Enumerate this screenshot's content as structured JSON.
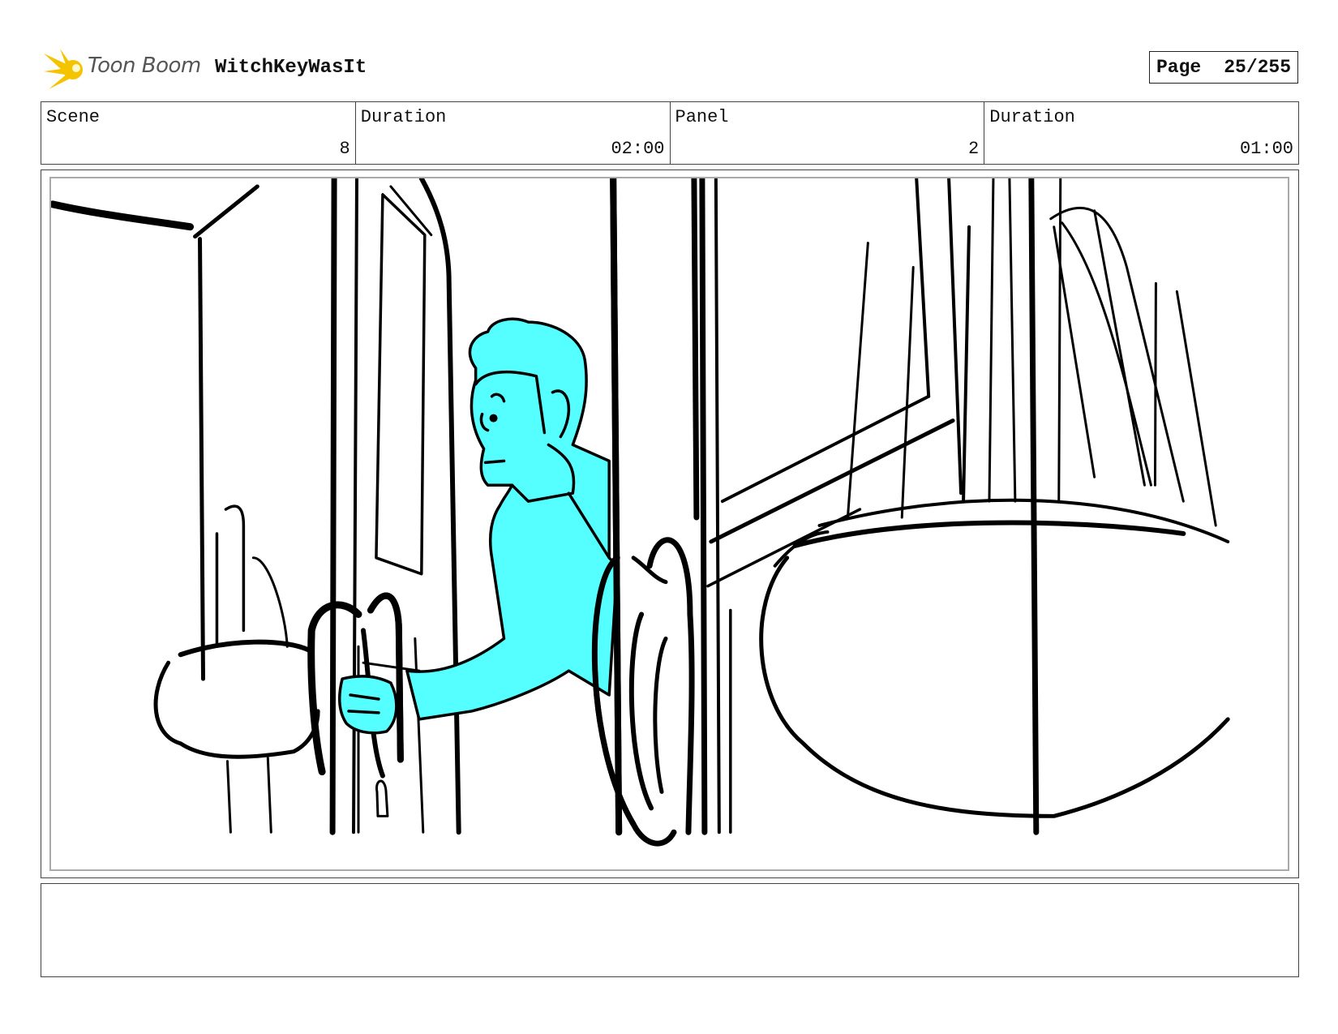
{
  "header": {
    "brand": "Toon Boom",
    "project": "WitchKeyWasIt",
    "page_label": "Page",
    "page_value": "25/255"
  },
  "info": {
    "scene_label": "Scene",
    "scene_value": "8",
    "scene_duration_label": "Duration",
    "scene_duration_value": "02:00",
    "panel_label": "Panel",
    "panel_value": "2",
    "panel_duration_label": "Duration",
    "panel_duration_value": "01:00"
  },
  "notes": {
    "text": ""
  },
  "colors": {
    "character_fill": "#55ffff",
    "line": "#000000",
    "logo": "#f5c400"
  }
}
